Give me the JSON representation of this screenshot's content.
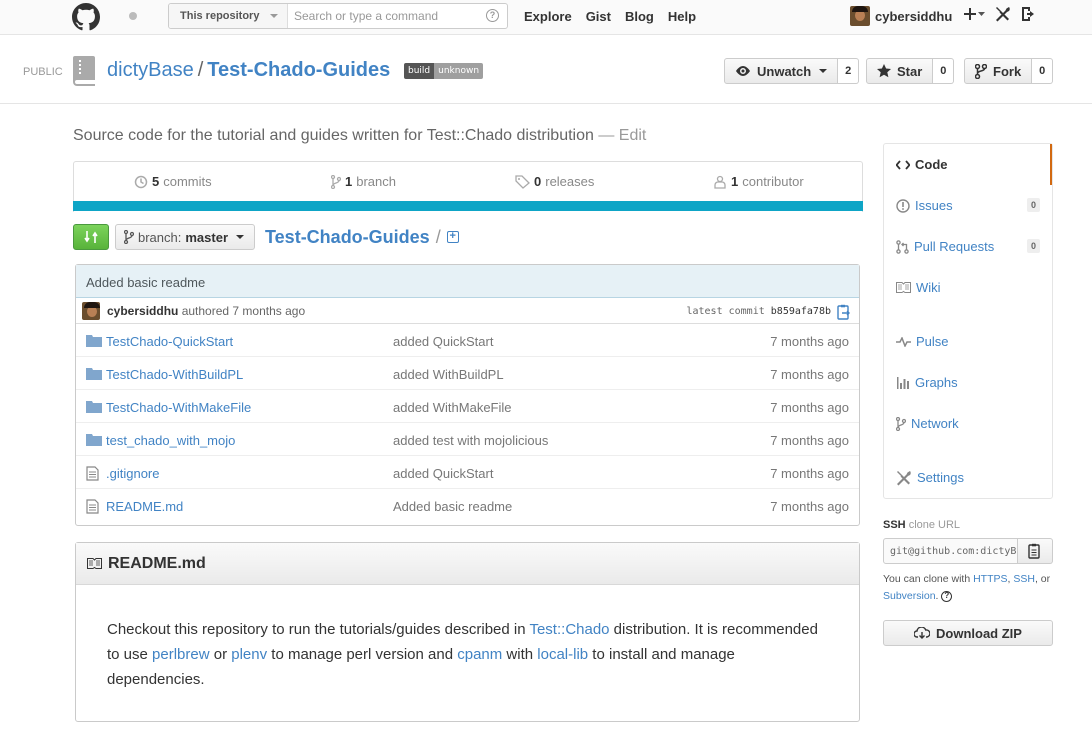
{
  "header": {
    "scope_label": "This repository",
    "search_placeholder": "Search or type a command",
    "nav": [
      "Explore",
      "Gist",
      "Blog",
      "Help"
    ],
    "username": "cybersiddhu"
  },
  "repo": {
    "visibility": "PUBLIC",
    "owner": "dictyBase",
    "name": "Test-Chado-Guides",
    "badge_left": "build",
    "badge_right": "unknown",
    "unwatch_label": "Unwatch",
    "unwatch_count": "2",
    "star_label": "Star",
    "star_count": "0",
    "fork_label": "Fork",
    "fork_count": "0",
    "description": "Source code for the tutorial and guides written for Test::Chado distribution",
    "edit_label": "— Edit"
  },
  "numbers": {
    "commits_count": "5",
    "commits_label": "commits",
    "branch_count": "1",
    "branch_label": "branch",
    "releases_count": "0",
    "releases_label": "releases",
    "contributor_count": "1",
    "contributor_label": "contributor"
  },
  "file_nav": {
    "branch_prefix": "branch:",
    "branch_name": "master",
    "breadcrumb": "Test-Chado-Guides",
    "slash": "/"
  },
  "last_commit": {
    "message": "Added basic readme",
    "author": "cybersiddhu",
    "authored": "authored 7 months ago",
    "latest_label": "latest commit",
    "sha": "b859afa78b"
  },
  "files": [
    {
      "name": "TestChado-QuickStart",
      "message": "added QuickStart",
      "age": "7 months ago",
      "type": "dir"
    },
    {
      "name": "TestChado-WithBuildPL",
      "message": "added WithBuildPL",
      "age": "7 months ago",
      "type": "dir"
    },
    {
      "name": "TestChado-WithMakeFile",
      "message": "added WithMakeFile",
      "age": "7 months ago",
      "type": "dir"
    },
    {
      "name": "test_chado_with_mojo",
      "message": "added test with mojolicious",
      "age": "7 months ago",
      "type": "dir"
    },
    {
      "name": ".gitignore",
      "message": "added QuickStart",
      "age": "7 months ago",
      "type": "file"
    },
    {
      "name": "README.md",
      "message": "Added basic readme",
      "age": "7 months ago",
      "type": "file"
    }
  ],
  "readme": {
    "title": "README.md",
    "t1": "Checkout this repository to run the tutorials/guides described in ",
    "l1": "Test::Chado",
    "t2": " distribution. It is recommended to use ",
    "l2": "perlbrew",
    "t3": " or ",
    "l3": "plenv",
    "t4": " to manage perl version and ",
    "l4": "cpanm",
    "t5": " with ",
    "l5": "local-lib",
    "t6": " to install and manage dependencies."
  },
  "sidebar": {
    "code": "Code",
    "issues": "Issues",
    "issues_count": "0",
    "pulls": "Pull Requests",
    "pulls_count": "0",
    "wiki": "Wiki",
    "pulse": "Pulse",
    "graphs": "Graphs",
    "network": "Network",
    "settings": "Settings",
    "clone_proto": "SSH",
    "clone_suffix": "clone URL",
    "clone_url": "git@github.com:dictyBase/Test-Chado-Guides.git",
    "clone_help_1": "You can clone with ",
    "clone_https": "HTTPS",
    "clone_comma": ", ",
    "clone_ssh": "SSH",
    "clone_help_2": ", or ",
    "clone_svn": "Subversion",
    "clone_help_3": ".",
    "download": "Download ZIP"
  },
  "colors": {
    "link": "#4183c4",
    "language_bar": "#0ea5c6",
    "compare_green": "#6cc644",
    "selected_nav": "#d26911"
  }
}
